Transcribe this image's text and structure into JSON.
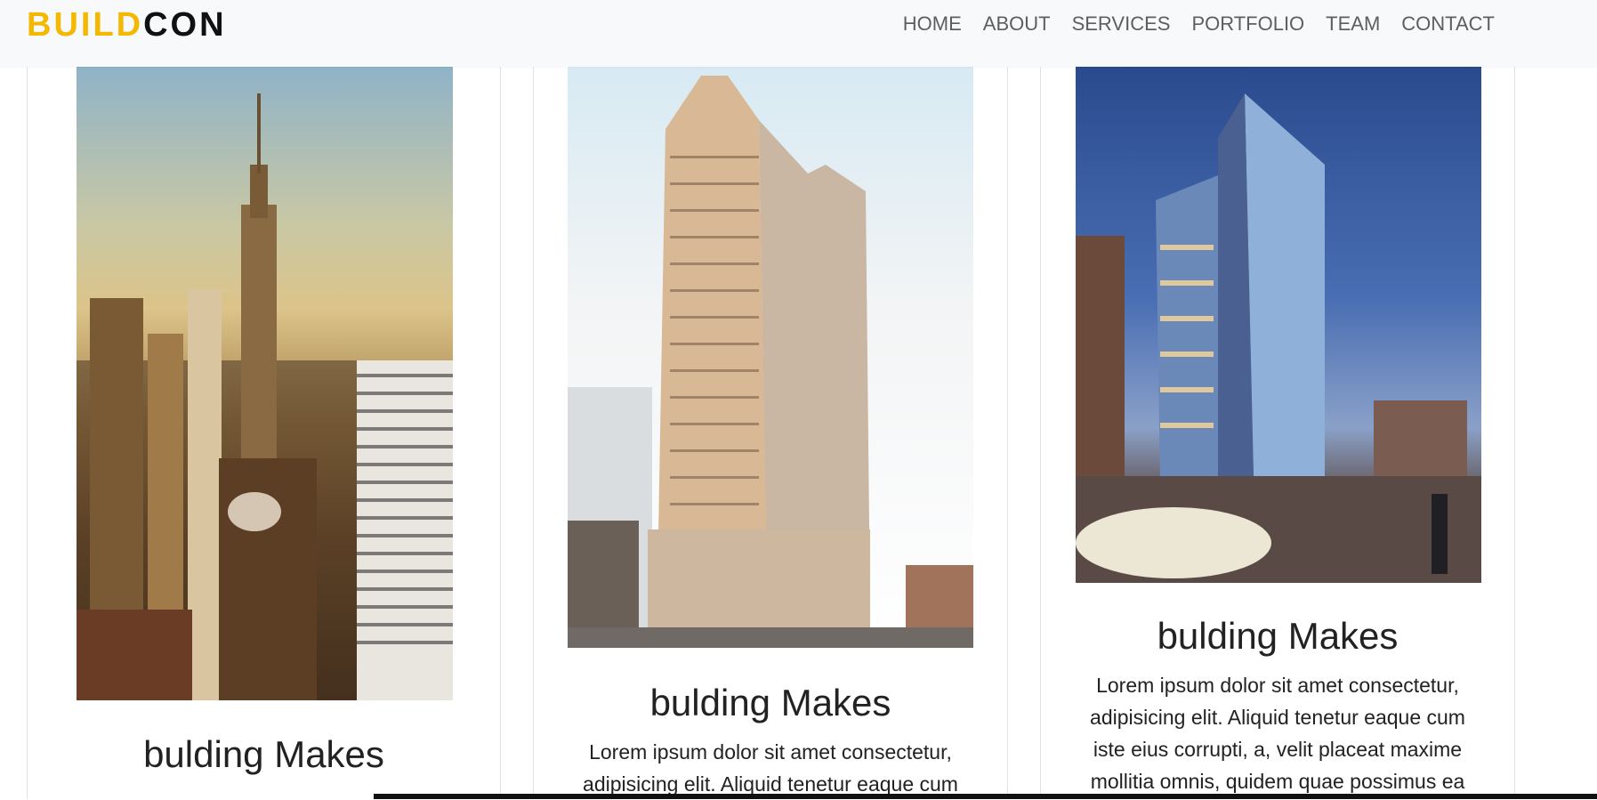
{
  "brand": {
    "part1": "BUILD",
    "part2": "CON"
  },
  "nav": {
    "items": [
      "HOME",
      "ABOUT",
      "SERVICES",
      "PORTFOLIO",
      "TEAM",
      "CONTACT"
    ]
  },
  "cards": [
    {
      "title": "bulding Makes",
      "text": "",
      "image_alt": "building-photo"
    },
    {
      "title": "bulding Makes",
      "text": "Lorem ipsum dolor sit amet consectetur, adipisicing elit. Aliquid tenetur eaque cum",
      "image_alt": "building-photo"
    },
    {
      "title": "bulding Makes",
      "text": "Lorem ipsum dolor sit amet consectetur, adipisicing elit. Aliquid tenetur eaque cum iste eius corrupti, a, velit placeat maxime mollitia omnis, quidem quae possimus ea",
      "image_alt": "building-photo"
    }
  ],
  "colors": {
    "brand_accent": "#f5b800",
    "navbar_bg": "#f8f9fa",
    "nav_text": "#5e5e5e"
  }
}
